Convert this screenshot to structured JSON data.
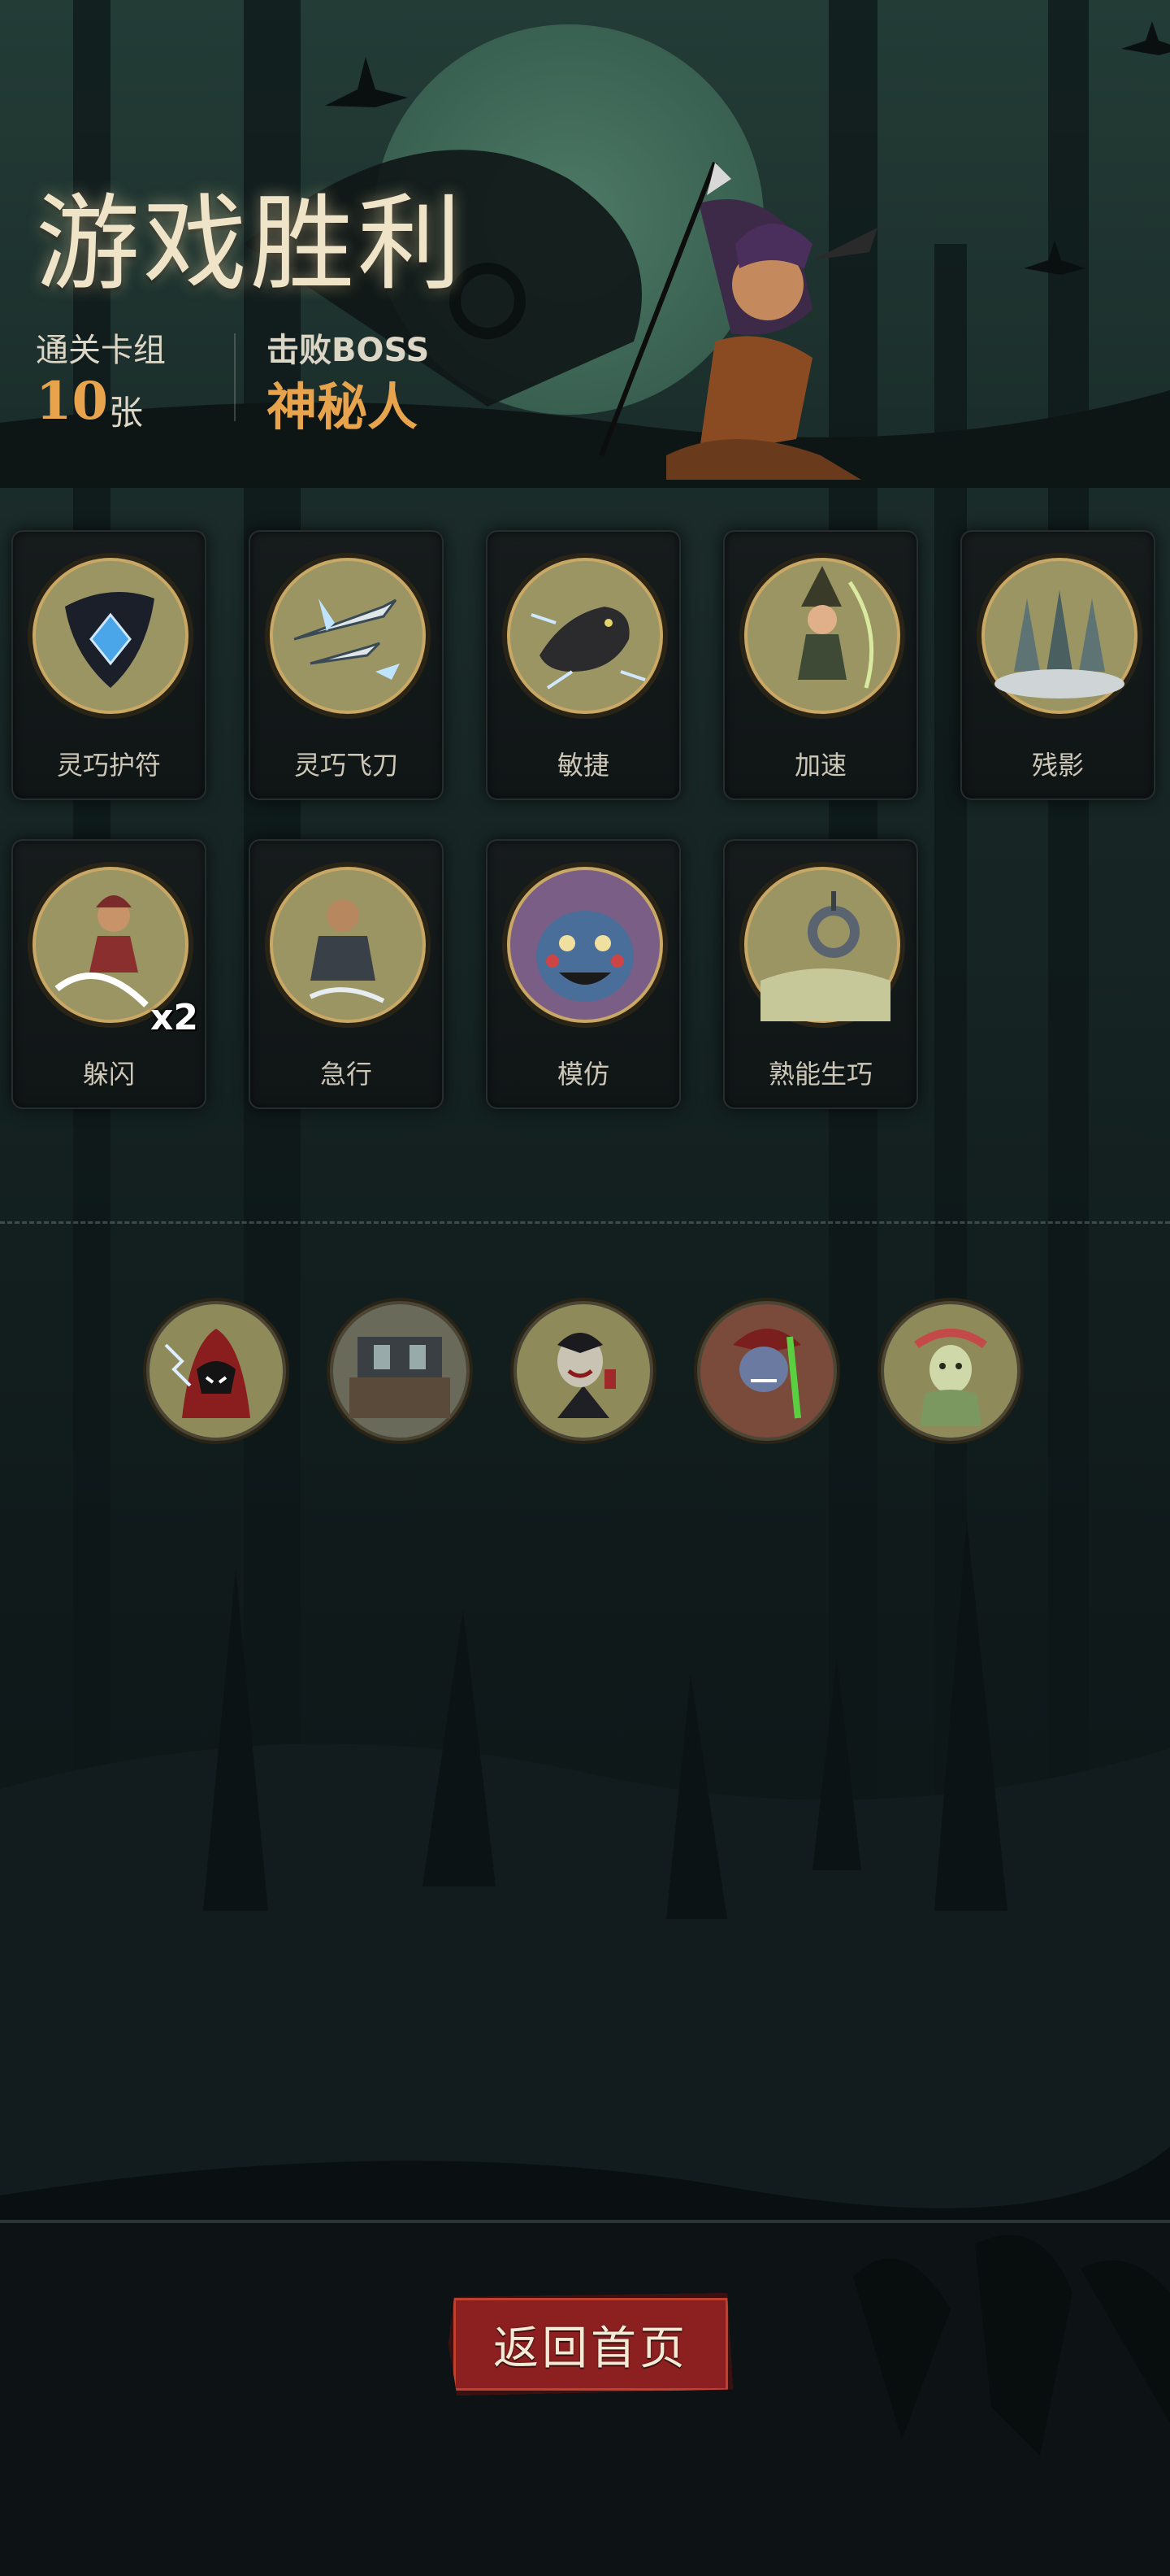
{
  "header": {
    "title": "游戏胜利",
    "cleared_deck_label": "通关卡组",
    "cleared_deck_count": "10",
    "cleared_deck_unit": "张",
    "defeated_boss_label": "击败BOSS",
    "defeated_boss_name": "神秘人"
  },
  "cards": [
    {
      "label": "灵巧护符",
      "icon": "agile-amulet-icon"
    },
    {
      "label": "灵巧飞刀",
      "icon": "agile-throwing-knives-icon"
    },
    {
      "label": "敏捷",
      "icon": "agility-panther-icon"
    },
    {
      "label": "加速",
      "icon": "haste-witch-icon"
    },
    {
      "label": "残影",
      "icon": "afterimage-hooded-figures-icon"
    },
    {
      "label": "躲闪",
      "icon": "dodge-rogue-icon",
      "badge": "x2"
    },
    {
      "label": "急行",
      "icon": "dash-warrior-icon"
    },
    {
      "label": "模仿",
      "icon": "mimic-troll-face-icon"
    },
    {
      "label": "熟能生巧",
      "icon": "practice-makes-perfect-icon"
    }
  ],
  "bosses": [
    {
      "icon": "hooded-mage-boss-icon"
    },
    {
      "icon": "kitchen-boss-icon"
    },
    {
      "icon": "vampire-boss-icon"
    },
    {
      "icon": "goblin-chemist-boss-icon"
    },
    {
      "icon": "forest-dryad-boss-icon"
    }
  ],
  "footer": {
    "return_home_label": "返回首页"
  },
  "colors": {
    "accent_orange": "#e8a44c",
    "button_red": "#8c2020",
    "moon_green": "#4f7f6a",
    "icon_bg": "#8f8a5a"
  }
}
